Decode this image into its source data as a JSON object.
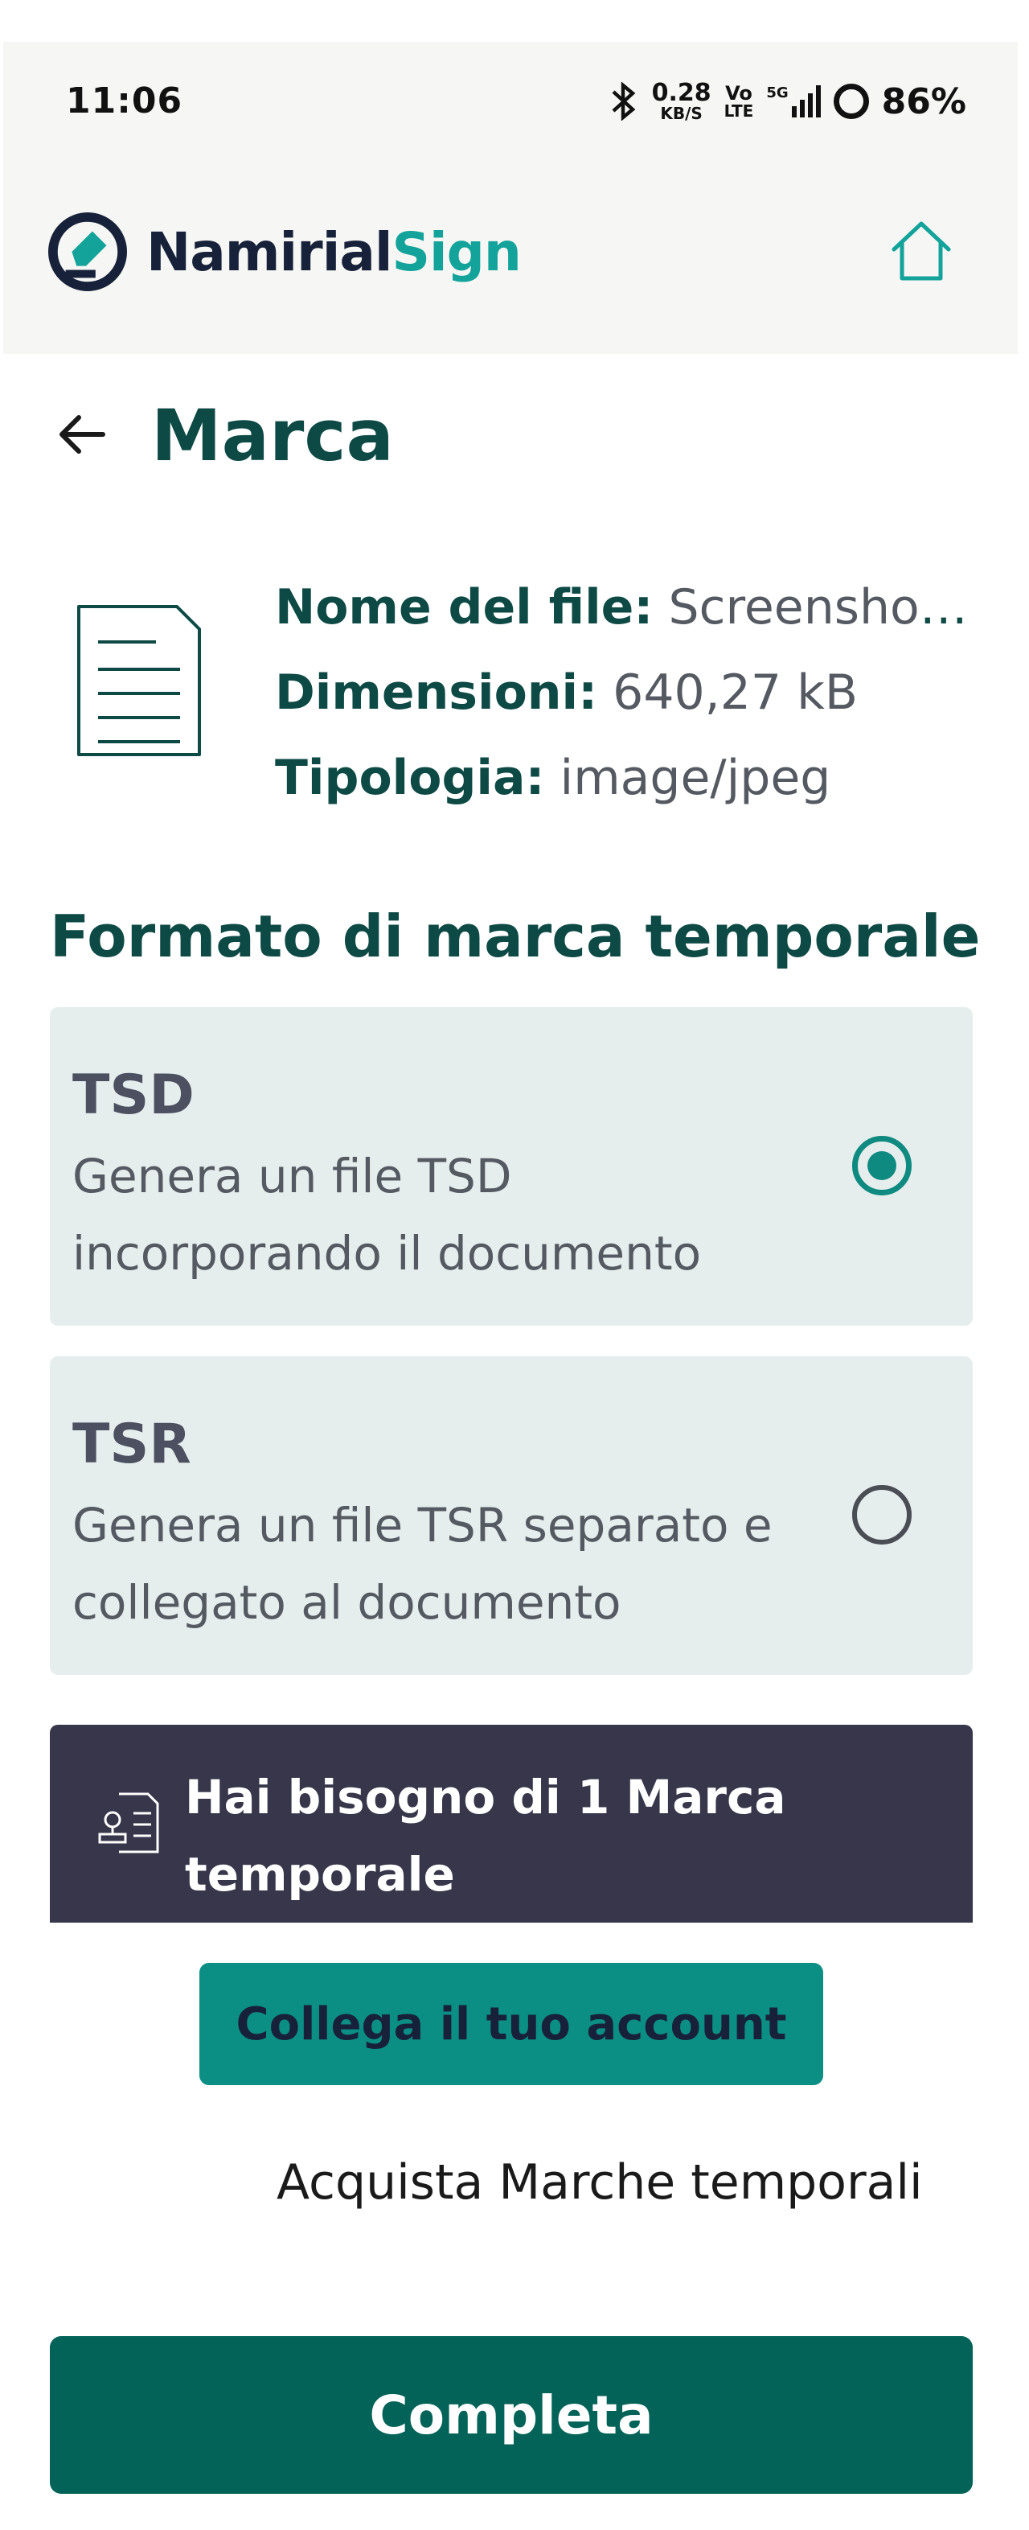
{
  "status_bar": {
    "time": "11:06",
    "net_speed_value": "0.28",
    "net_speed_unit": "KB/S",
    "volte_top": "Vo",
    "volte_bottom": "LTE",
    "network": "5G",
    "battery": "86%",
    "icons": [
      "bluetooth-icon",
      "signal-icon",
      "battery-ring-icon"
    ]
  },
  "header": {
    "logo_primary": "Namirial",
    "logo_secondary": "Sign",
    "home_icon": "home-icon"
  },
  "colors": {
    "brand_dark": "#0e4a45",
    "brand_teal": "#13a39a",
    "option_bg": "#e6eeed",
    "banner_bg": "#37364a",
    "button_teal": "#0b8f84",
    "button_primary": "#036358"
  },
  "page": {
    "title": "Marca",
    "back_icon": "arrow-left-icon"
  },
  "file": {
    "name_label": "Nome del file:",
    "name_value": "Screenshot_...",
    "size_label": "Dimensioni:",
    "size_value": "640,27 kB",
    "type_label": "Tipologia:",
    "type_value": "image/jpeg",
    "icon": "document-icon"
  },
  "format": {
    "section_title": "Formato di marca temporale",
    "options": [
      {
        "title": "TSD",
        "description": "Genera un file TSD incorporando il documento",
        "selected": true
      },
      {
        "title": "TSR",
        "description": "Genera un file TSR separato e collegato al documento",
        "selected": false
      }
    ]
  },
  "banner": {
    "text": "Hai bisogno di 1 Marca temporale",
    "icon": "stamp-document-icon"
  },
  "actions": {
    "link_account": "Collega il tuo account",
    "buy_timestamps": "Acquista Marche temporali",
    "complete": "Completa"
  }
}
